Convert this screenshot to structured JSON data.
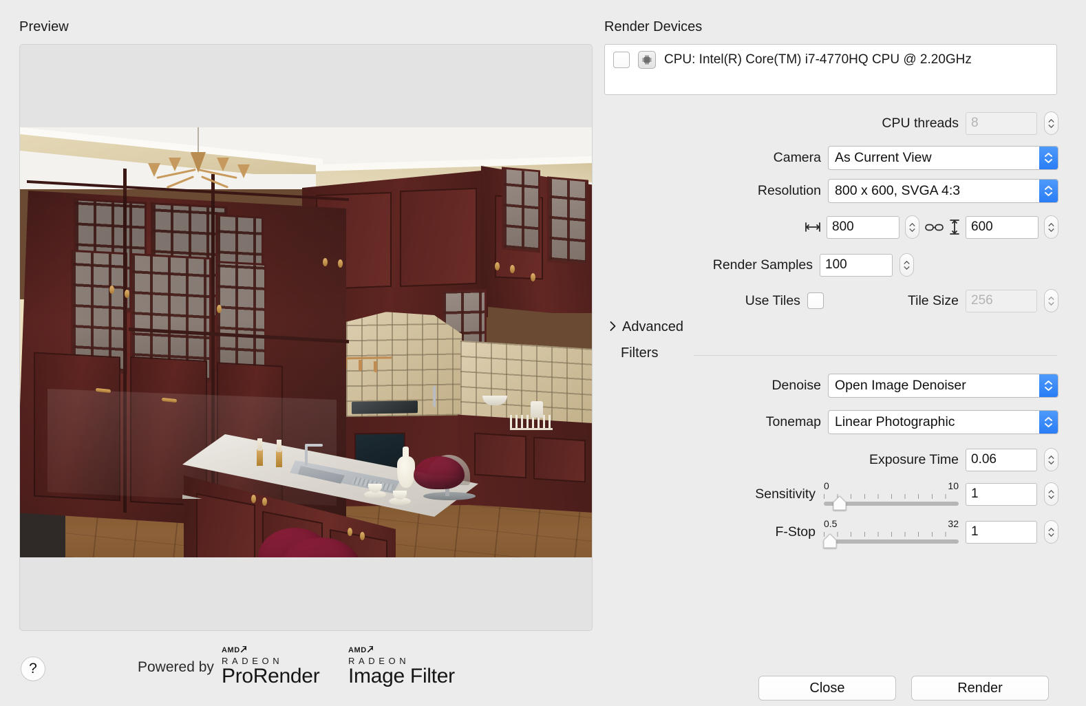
{
  "preview": {
    "title": "Preview",
    "scene_description": "Rendered 3D kitchen interior with dark cherry cabinets, granite island, sink, burgundy barstools, chandelier and hardwood floor"
  },
  "footer": {
    "help_icon": "question-mark-icon",
    "powered_by": "Powered by",
    "logos": [
      {
        "brand": "AMD",
        "family": "RADEON",
        "product": "ProRender"
      },
      {
        "brand": "AMD",
        "family": "RADEON",
        "product": "Image Filter"
      }
    ]
  },
  "render_devices": {
    "title": "Render Devices",
    "items": [
      {
        "checked": false,
        "icon": "cpu-chip-icon",
        "label": "CPU: Intel(R) Core(TM) i7-4770HQ CPU @ 2.20GHz"
      }
    ]
  },
  "settings": {
    "cpu_threads": {
      "label": "CPU threads",
      "value": "8",
      "disabled": true
    },
    "camera": {
      "label": "Camera",
      "value": "As Current View"
    },
    "resolution": {
      "label": "Resolution",
      "value": "800 x 600, SVGA 4:3"
    },
    "width": {
      "icon": "arrow-horizontal-icon",
      "value": "800"
    },
    "link_icon": "chain-link-icon",
    "height": {
      "icon": "arrow-vertical-icon",
      "value": "600"
    },
    "render_samples": {
      "label": "Render Samples",
      "value": "100"
    },
    "use_tiles": {
      "label": "Use Tiles",
      "checked": false
    },
    "tile_size": {
      "label": "Tile Size",
      "value": "256",
      "disabled": true
    }
  },
  "advanced": {
    "label": "Advanced",
    "caret": "chevron-right-icon",
    "expanded": false
  },
  "filters": {
    "label": "Filters",
    "denoise": {
      "label": "Denoise",
      "value": "Open Image Denoiser"
    },
    "tonemap": {
      "label": "Tonemap",
      "value": "Linear Photographic"
    },
    "exposure_time": {
      "label": "Exposure Time",
      "value": "0.06"
    },
    "sensitivity": {
      "label": "Sensitivity",
      "value": "1",
      "min": "0",
      "max": "10",
      "fill": 10
    },
    "fstop": {
      "label": "F-Stop",
      "value": "1",
      "min": "0.5",
      "max": "32",
      "fill": 2
    }
  },
  "buttons": {
    "close": "Close",
    "render": "Render"
  },
  "colors": {
    "window_bg": "#ececec",
    "accent_blue": "#2a7df5",
    "field_bg": "#ffffff",
    "disabled_text": "#b3b3b3",
    "border": "#c4c4c4"
  }
}
